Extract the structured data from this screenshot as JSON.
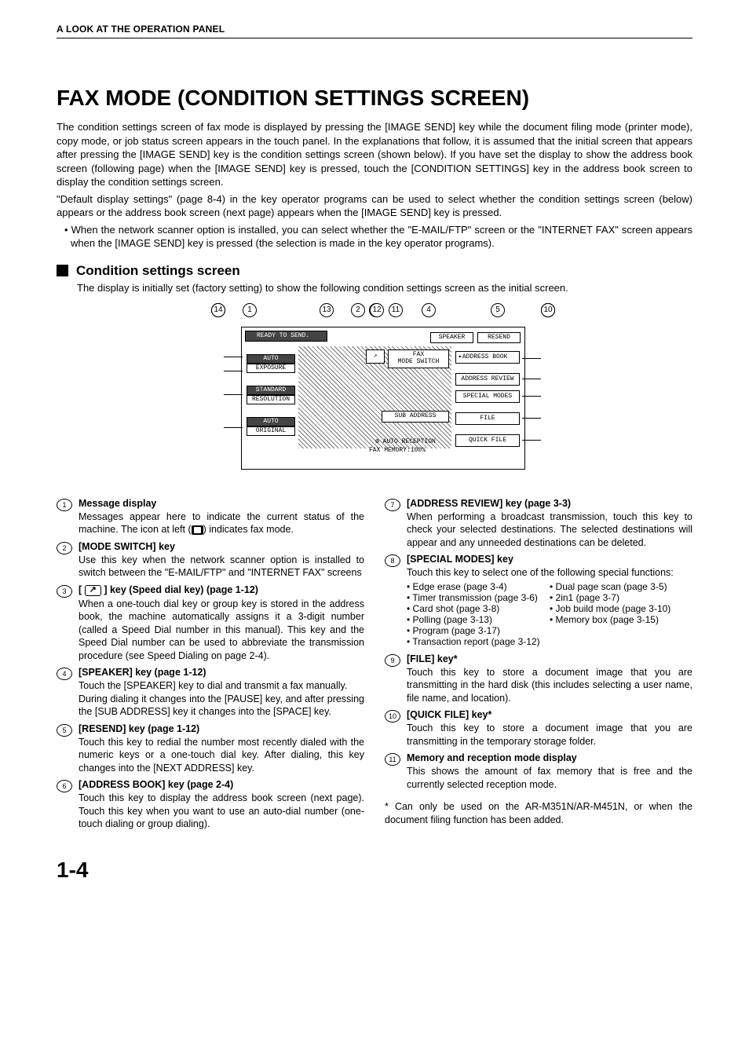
{
  "header": "A LOOK AT THE OPERATION PANEL",
  "title": "FAX MODE (CONDITION SETTINGS SCREEN)",
  "intro": {
    "p1": "The condition settings screen of fax mode is displayed by pressing the [IMAGE SEND] key while the document filing mode (printer mode), copy mode, or job status screen appears in the touch panel. In the explanations that follow, it is assumed that the initial screen that appears after pressing the [IMAGE SEND] key is the condition settings screen (shown below). If you have set the display to show the address book screen (following page) when the [IMAGE SEND] key is pressed, touch the [CONDITION SETTINGS] key in the address book screen to display the condition settings screen.",
    "p2": "\"Default display settings\" (page 8-4) in the key operator programs can be used to select whether the condition settings screen (below) appears or the address book screen (next page) appears when the [IMAGE SEND] key is pressed.",
    "bullet": "• When the network scanner option is installed, you can select whether the \"E-MAIL/FTP\" screen or the \"INTERNET FAX\" screen appears when the [IMAGE SEND] key is pressed (the selection is made in the key operator programs)."
  },
  "sub": {
    "heading": "Condition settings screen",
    "note": "The display is initially set (factory setting) to show the following condition settings screen as the initial screen."
  },
  "diagram": {
    "ready": "READY TO SEND.",
    "speaker": "SPEAKER",
    "resend": "RESEND",
    "auto": "AUTO",
    "exposure": "EXPOSURE",
    "standard": "STANDARD",
    "resolution": "RESOLUTION",
    "auto2": "AUTO",
    "original": "ORIGINAL",
    "fax": "FAX",
    "mode_switch": "MODE SWITCH",
    "address_book": "ADDRESS BOOK",
    "address_review": "ADDRESS REVIEW",
    "special_modes": "SPECIAL MODES",
    "file": "FILE",
    "quick_file": "QUICK FILE",
    "sub_address": "SUB ADDRESS",
    "auto_reception": "AUTO RECEPTION",
    "fax_memory": "FAX MEMORY:100%"
  },
  "items_left": [
    {
      "n": "1",
      "title": "Message display",
      "desc": "Messages appear here to indicate the current status of the machine. The icon at left (    ) indicates fax mode."
    },
    {
      "n": "2",
      "title": "[MODE SWITCH] key",
      "desc": "Use this key when the network scanner option is installed to switch between the \"E-MAIL/FTP\" and \"INTERNET FAX\" screens"
    },
    {
      "n": "3",
      "title_html": true,
      "desc": "When a one-touch dial key or group key is stored in the address book, the machine automatically assigns it a 3-digit number (called a Speed Dial number in this manual). This key and the Speed Dial number can be used to abbreviate the transmission procedure (see Speed Dialing on page 2-4)."
    },
    {
      "n": "4",
      "title": "[SPEAKER] key (page 1-12)",
      "desc": "Touch the [SPEAKER] key to dial and transmit a fax manually.\nDuring dialing it changes into the [PAUSE] key, and after pressing the [SUB ADDRESS] key it changes into the [SPACE] key."
    },
    {
      "n": "5",
      "title": "[RESEND] key (page 1-12)",
      "desc": "Touch this key to redial the number most recently dialed with the numeric keys or a one-touch dial key. After dialing, this key changes into the [NEXT ADDRESS] key."
    },
    {
      "n": "6",
      "title": "[ADDRESS BOOK] key (page 2-4)",
      "desc": "Touch this key to display the address book screen (next page). Touch this key when you want to use an auto-dial number (one-touch dialing or group dialing)."
    }
  ],
  "items_right": [
    {
      "n": "7",
      "title": "[ADDRESS REVIEW] key (page 3-3)",
      "desc": "When performing a broadcast transmission, touch this key to check your selected destinations. The selected destinations will appear and any unneeded destinations can be deleted."
    },
    {
      "n": "8",
      "title": "[SPECIAL MODES] key",
      "desc": "Touch this key to select one of the following special functions:"
    },
    {
      "n": "9",
      "title": "[FILE] key*",
      "desc": "Touch this key to store a document image that you are transmitting in the hard disk (this includes selecting a user name, file name, and location)."
    },
    {
      "n": "10",
      "title": "[QUICK FILE] key*",
      "desc": "Touch this key to store a document image that you are transmitting in the temporary storage folder."
    },
    {
      "n": "11",
      "title": "Memory and reception mode display",
      "desc": "This shows the amount of fax memory that is free and the currently selected reception mode."
    }
  ],
  "special_modes_bullets": [
    [
      "Edge erase (page 3-4)",
      "Dual page scan (page 3-5)"
    ],
    [
      "Timer transmission (page 3-6)",
      "2in1 (page 3-7)"
    ],
    [
      "Card shot (page 3-8)",
      "Job build mode (page 3-10)"
    ],
    [
      "Polling (page 3-13)",
      "Memory box (page 3-15)"
    ],
    [
      "Program (page 3-17)",
      ""
    ],
    [
      "Transaction report (page 3-12)",
      ""
    ]
  ],
  "item3_title_parts": {
    "a": "[ ",
    "b": " ] key (Speed dial key)  (page 1-12)"
  },
  "footnote": "Can only be used on the AR-M351N/AR-M451N, or when the document filing function has been added.",
  "page_number": "1-4"
}
